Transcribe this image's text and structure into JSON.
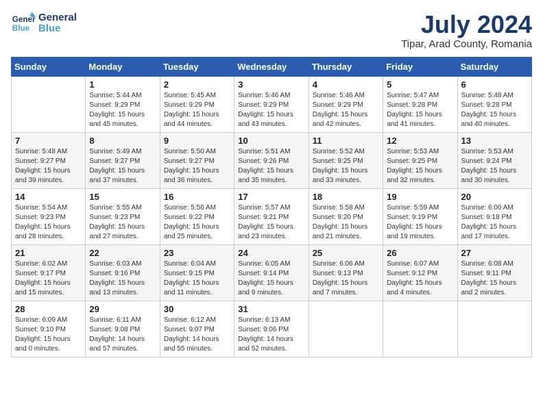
{
  "header": {
    "logo_line1": "General",
    "logo_line2": "Blue",
    "month_year": "July 2024",
    "location": "Tipar, Arad County, Romania"
  },
  "weekdays": [
    "Sunday",
    "Monday",
    "Tuesday",
    "Wednesday",
    "Thursday",
    "Friday",
    "Saturday"
  ],
  "weeks": [
    [
      {
        "day": "",
        "content": ""
      },
      {
        "day": "1",
        "content": "Sunrise: 5:44 AM\nSunset: 9:29 PM\nDaylight: 15 hours\nand 45 minutes."
      },
      {
        "day": "2",
        "content": "Sunrise: 5:45 AM\nSunset: 9:29 PM\nDaylight: 15 hours\nand 44 minutes."
      },
      {
        "day": "3",
        "content": "Sunrise: 5:46 AM\nSunset: 9:29 PM\nDaylight: 15 hours\nand 43 minutes."
      },
      {
        "day": "4",
        "content": "Sunrise: 5:46 AM\nSunset: 9:29 PM\nDaylight: 15 hours\nand 42 minutes."
      },
      {
        "day": "5",
        "content": "Sunrise: 5:47 AM\nSunset: 9:28 PM\nDaylight: 15 hours\nand 41 minutes."
      },
      {
        "day": "6",
        "content": "Sunrise: 5:48 AM\nSunset: 9:28 PM\nDaylight: 15 hours\nand 40 minutes."
      }
    ],
    [
      {
        "day": "7",
        "content": "Sunrise: 5:48 AM\nSunset: 9:27 PM\nDaylight: 15 hours\nand 39 minutes."
      },
      {
        "day": "8",
        "content": "Sunrise: 5:49 AM\nSunset: 9:27 PM\nDaylight: 15 hours\nand 37 minutes."
      },
      {
        "day": "9",
        "content": "Sunrise: 5:50 AM\nSunset: 9:27 PM\nDaylight: 15 hours\nand 36 minutes."
      },
      {
        "day": "10",
        "content": "Sunrise: 5:51 AM\nSunset: 9:26 PM\nDaylight: 15 hours\nand 35 minutes."
      },
      {
        "day": "11",
        "content": "Sunrise: 5:52 AM\nSunset: 9:25 PM\nDaylight: 15 hours\nand 33 minutes."
      },
      {
        "day": "12",
        "content": "Sunrise: 5:53 AM\nSunset: 9:25 PM\nDaylight: 15 hours\nand 32 minutes."
      },
      {
        "day": "13",
        "content": "Sunrise: 5:53 AM\nSunset: 9:24 PM\nDaylight: 15 hours\nand 30 minutes."
      }
    ],
    [
      {
        "day": "14",
        "content": "Sunrise: 5:54 AM\nSunset: 9:23 PM\nDaylight: 15 hours\nand 28 minutes."
      },
      {
        "day": "15",
        "content": "Sunrise: 5:55 AM\nSunset: 9:23 PM\nDaylight: 15 hours\nand 27 minutes."
      },
      {
        "day": "16",
        "content": "Sunrise: 5:56 AM\nSunset: 9:22 PM\nDaylight: 15 hours\nand 25 minutes."
      },
      {
        "day": "17",
        "content": "Sunrise: 5:57 AM\nSunset: 9:21 PM\nDaylight: 15 hours\nand 23 minutes."
      },
      {
        "day": "18",
        "content": "Sunrise: 5:58 AM\nSunset: 9:20 PM\nDaylight: 15 hours\nand 21 minutes."
      },
      {
        "day": "19",
        "content": "Sunrise: 5:59 AM\nSunset: 9:19 PM\nDaylight: 15 hours\nand 19 minutes."
      },
      {
        "day": "20",
        "content": "Sunrise: 6:00 AM\nSunset: 9:18 PM\nDaylight: 15 hours\nand 17 minutes."
      }
    ],
    [
      {
        "day": "21",
        "content": "Sunrise: 6:02 AM\nSunset: 9:17 PM\nDaylight: 15 hours\nand 15 minutes."
      },
      {
        "day": "22",
        "content": "Sunrise: 6:03 AM\nSunset: 9:16 PM\nDaylight: 15 hours\nand 13 minutes."
      },
      {
        "day": "23",
        "content": "Sunrise: 6:04 AM\nSunset: 9:15 PM\nDaylight: 15 hours\nand 11 minutes."
      },
      {
        "day": "24",
        "content": "Sunrise: 6:05 AM\nSunset: 9:14 PM\nDaylight: 15 hours\nand 9 minutes."
      },
      {
        "day": "25",
        "content": "Sunrise: 6:06 AM\nSunset: 9:13 PM\nDaylight: 15 hours\nand 7 minutes."
      },
      {
        "day": "26",
        "content": "Sunrise: 6:07 AM\nSunset: 9:12 PM\nDaylight: 15 hours\nand 4 minutes."
      },
      {
        "day": "27",
        "content": "Sunrise: 6:08 AM\nSunset: 9:11 PM\nDaylight: 15 hours\nand 2 minutes."
      }
    ],
    [
      {
        "day": "28",
        "content": "Sunrise: 6:09 AM\nSunset: 9:10 PM\nDaylight: 15 hours\nand 0 minutes."
      },
      {
        "day": "29",
        "content": "Sunrise: 6:11 AM\nSunset: 9:08 PM\nDaylight: 14 hours\nand 57 minutes."
      },
      {
        "day": "30",
        "content": "Sunrise: 6:12 AM\nSunset: 9:07 PM\nDaylight: 14 hours\nand 55 minutes."
      },
      {
        "day": "31",
        "content": "Sunrise: 6:13 AM\nSunset: 9:06 PM\nDaylight: 14 hours\nand 52 minutes."
      },
      {
        "day": "",
        "content": ""
      },
      {
        "day": "",
        "content": ""
      },
      {
        "day": "",
        "content": ""
      }
    ]
  ]
}
